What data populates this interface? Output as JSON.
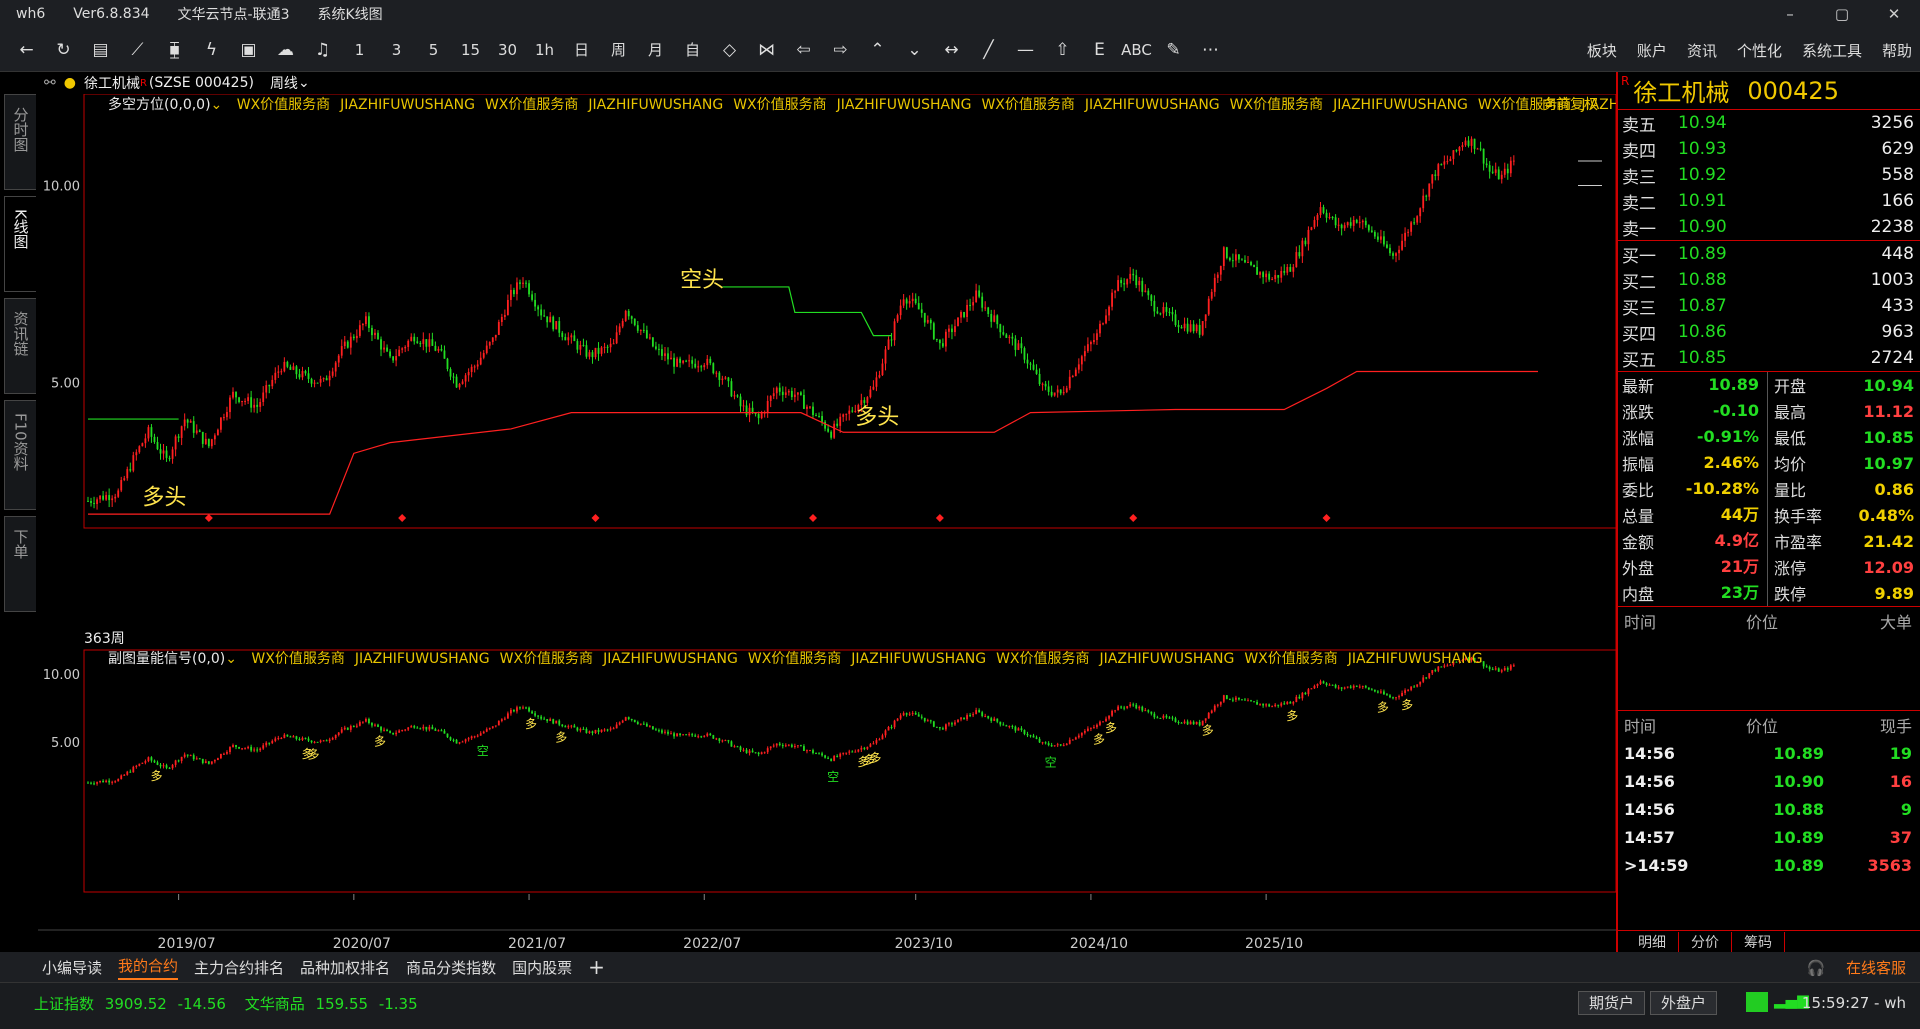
{
  "titlebar": {
    "app": "wh6",
    "version": "Ver6.8.834",
    "node": "文华云节点-联通3",
    "view": "系统K线图"
  },
  "window_controls": [
    "–",
    "▢",
    "✕"
  ],
  "toolbar": {
    "periods": [
      "1",
      "3",
      "5",
      "15",
      "30",
      "1h",
      "日",
      "周",
      "月",
      "自"
    ],
    "abc": "ABC",
    "right_menu": [
      "板块",
      "账户",
      "资讯",
      "个性化",
      "系统工具",
      "帮助"
    ]
  },
  "left_tabs": [
    "分时图",
    "K线图",
    "资讯链",
    "F10资料",
    "下单"
  ],
  "chart_info": {
    "name": "徐工机械",
    "tag": "R",
    "code": "(SZSE 000425)",
    "period": "周线"
  },
  "main_indicator": {
    "name": "多空方位(0,0,0)",
    "watermark": [
      "WX价值服务商",
      "JIAZHIFUWUSHANG",
      "WX价值服务商",
      "JIAZHIFUWUSHANG",
      "WX价值服务商",
      "JIAZHIFUWUSHANG",
      "WX价值服务商",
      "JIAZHIFUWUSHANG",
      "WX价值服务商",
      "JIAZHIFUWUSHANG",
      "WX价值服务商",
      "JIAZHIFUWUSHANG"
    ],
    "adjust": "向前复权",
    "bar_count": "363周"
  },
  "sub_indicator": {
    "name": "副图量能信号(0,0)",
    "watermark": [
      "WX价值服务商",
      "JIAZHIFUWUSHANG",
      "WX价值服务商",
      "JIAZHIFUWUSHANG",
      "WX价值服务商",
      "JIAZHIFUWUSHANG",
      "WX价值服务商",
      "JIAZHIFUWUSHANG",
      "WX价值服务商",
      "JIAZHIFUWUSHANG"
    ]
  },
  "chart_data": {
    "type": "candlestick",
    "period": "weekly",
    "x_ticks": [
      "2019/07",
      "2020/07",
      "2021/07",
      "2022/07",
      "2023/10",
      "2024/10",
      "2025/10"
    ],
    "y_ticks_main": [
      5.0,
      10.0
    ],
    "y_ticks_sub": [
      5.0,
      10.0
    ],
    "ylim": [
      3.0,
      12.5
    ],
    "close_path": [
      [
        0,
        3.3
      ],
      [
        10,
        3.4
      ],
      [
        16,
        3.9
      ],
      [
        20,
        4.2
      ],
      [
        26,
        3.8
      ],
      [
        32,
        4.4
      ],
      [
        40,
        4.0
      ],
      [
        48,
        4.8
      ],
      [
        56,
        4.6
      ],
      [
        64,
        5.3
      ],
      [
        72,
        5.1
      ],
      [
        78,
        5.0
      ],
      [
        84,
        5.6
      ],
      [
        92,
        6.2
      ],
      [
        100,
        5.4
      ],
      [
        108,
        5.9
      ],
      [
        116,
        5.6
      ],
      [
        122,
        5.0
      ],
      [
        128,
        5.3
      ],
      [
        134,
        5.8
      ],
      [
        140,
        6.8
      ],
      [
        144,
        7.2
      ],
      [
        150,
        6.4
      ],
      [
        158,
        5.9
      ],
      [
        166,
        5.5
      ],
      [
        174,
        5.7
      ],
      [
        178,
        6.5
      ],
      [
        182,
        6.1
      ],
      [
        188,
        5.6
      ],
      [
        196,
        5.3
      ],
      [
        204,
        5.4
      ],
      [
        210,
        5.1
      ],
      [
        216,
        4.6
      ],
      [
        222,
        4.4
      ],
      [
        228,
        4.9
      ],
      [
        234,
        4.8
      ],
      [
        240,
        4.5
      ],
      [
        246,
        4.2
      ],
      [
        252,
        4.5
      ],
      [
        260,
        4.9
      ],
      [
        266,
        5.9
      ],
      [
        270,
        6.8
      ],
      [
        276,
        6.4
      ],
      [
        282,
        5.7
      ],
      [
        288,
        6.2
      ],
      [
        294,
        6.8
      ],
      [
        298,
        6.4
      ],
      [
        304,
        5.9
      ],
      [
        310,
        5.5
      ],
      [
        316,
        4.9
      ],
      [
        322,
        4.8
      ],
      [
        328,
        5.4
      ],
      [
        334,
        5.9
      ],
      [
        340,
        7.0
      ],
      [
        346,
        7.3
      ],
      [
        352,
        6.6
      ],
      [
        360,
        6.2
      ],
      [
        368,
        6.0
      ],
      [
        376,
        7.9
      ],
      [
        384,
        7.5
      ],
      [
        392,
        7.2
      ],
      [
        398,
        7.5
      ],
      [
        402,
        8.1
      ],
      [
        408,
        9.3
      ],
      [
        414,
        8.6
      ],
      [
        420,
        8.9
      ],
      [
        426,
        8.4
      ],
      [
        432,
        7.8
      ],
      [
        436,
        8.4
      ],
      [
        440,
        9.1
      ],
      [
        446,
        10.5
      ],
      [
        452,
        11.1
      ],
      [
        456,
        11.8
      ],
      [
        460,
        11.5
      ],
      [
        464,
        10.5
      ],
      [
        468,
        10.3
      ],
      [
        472,
        10.9
      ]
    ],
    "support_line": [
      [
        0,
        3.15
      ],
      [
        80,
        3.15
      ],
      [
        88,
        3.9
      ],
      [
        100,
        4.05
      ],
      [
        140,
        4.25
      ],
      [
        160,
        4.5
      ],
      [
        206,
        4.5
      ],
      [
        236,
        4.5
      ],
      [
        250,
        4.2
      ],
      [
        300,
        4.2
      ],
      [
        312,
        4.5
      ],
      [
        360,
        4.55
      ],
      [
        396,
        4.55
      ],
      [
        410,
        4.9
      ],
      [
        420,
        5.2
      ],
      [
        480,
        5.2
      ]
    ],
    "resistance_line": [
      [
        0,
        4.4
      ],
      [
        30,
        4.4
      ]
    ],
    "resistance_line2": [
      [
        210,
        7.0
      ],
      [
        232,
        7.0
      ],
      [
        234,
        6.4
      ],
      [
        256,
        6.4
      ],
      [
        260,
        5.9
      ],
      [
        266,
        5.9
      ]
    ],
    "signals": [
      {
        "label": "多头",
        "x": 18,
        "y": 3.35,
        "color": "#ffe44d"
      },
      {
        "label": "空头",
        "x": 196,
        "y": 7.2,
        "color": "#ffe44d"
      },
      {
        "label": "多头",
        "x": 254,
        "y": 4.45,
        "color": "#ffe44d"
      }
    ],
    "diamonds_x": [
      40,
      104,
      168,
      240,
      282,
      346,
      410
    ],
    "sub_marks": [
      {
        "t": "多",
        "x": 22
      },
      {
        "t": "多",
        "x": 72
      },
      {
        "t": "多",
        "x": 74
      },
      {
        "t": "多",
        "x": 96
      },
      {
        "t": "空",
        "x": 130
      },
      {
        "t": "多",
        "x": 146
      },
      {
        "t": "多",
        "x": 156
      },
      {
        "t": "空",
        "x": 246
      },
      {
        "t": "多",
        "x": 256
      },
      {
        "t": "多",
        "x": 258
      },
      {
        "t": "多",
        "x": 260
      },
      {
        "t": "空",
        "x": 318
      },
      {
        "t": "多",
        "x": 334
      },
      {
        "t": "多",
        "x": 338
      },
      {
        "t": "多",
        "x": 370
      },
      {
        "t": "多",
        "x": 398
      },
      {
        "t": "多",
        "x": 428
      },
      {
        "t": "多",
        "x": 436
      }
    ]
  },
  "quote": {
    "name": "徐工机械",
    "tag": "R",
    "code": "000425",
    "asks": [
      {
        "label": "卖五",
        "price": "10.94",
        "vol": "3256"
      },
      {
        "label": "卖四",
        "price": "10.93",
        "vol": "629"
      },
      {
        "label": "卖三",
        "price": "10.92",
        "vol": "558"
      },
      {
        "label": "卖二",
        "price": "10.91",
        "vol": "166"
      },
      {
        "label": "卖一",
        "price": "10.90",
        "vol": "2238"
      }
    ],
    "bids": [
      {
        "label": "买一",
        "price": "10.89",
        "vol": "448"
      },
      {
        "label": "买二",
        "price": "10.88",
        "vol": "1003"
      },
      {
        "label": "买三",
        "price": "10.87",
        "vol": "433"
      },
      {
        "label": "买四",
        "price": "10.86",
        "vol": "963"
      },
      {
        "label": "买五",
        "price": "10.85",
        "vol": "2724"
      }
    ],
    "stats": [
      {
        "l1": "最新",
        "v1": "10.89",
        "c1": "#22dd22",
        "l2": "开盘",
        "v2": "10.94",
        "c2": "#22dd22"
      },
      {
        "l1": "涨跌",
        "v1": "-0.10",
        "c1": "#22dd22",
        "l2": "最高",
        "v2": "11.12",
        "c2": "#ff4040"
      },
      {
        "l1": "涨幅",
        "v1": "-0.91%",
        "c1": "#22dd22",
        "l2": "最低",
        "v2": "10.85",
        "c2": "#22dd22"
      },
      {
        "l1": "振幅",
        "v1": "2.46%",
        "c1": "#f0d000",
        "l2": "均价",
        "v2": "10.97",
        "c2": "#22dd22"
      },
      {
        "l1": "委比",
        "v1": "-10.28%",
        "c1": "#f0d000",
        "l2": "量比",
        "v2": "0.86",
        "c2": "#f0d000"
      },
      {
        "l1": "总量",
        "v1": "44万",
        "c1": "#f0d000",
        "l2": "换手率",
        "v2": "0.48%",
        "c2": "#f0d000"
      },
      {
        "l1": "金额",
        "v1": "4.9亿",
        "c1": "#ff4040",
        "l2": "市盈率",
        "v2": "21.42",
        "c2": "#f0d000"
      },
      {
        "l1": "外盘",
        "v1": "21万",
        "c1": "#ff4040",
        "l2": "涨停",
        "v2": "12.09",
        "c2": "#ff4040"
      },
      {
        "l1": "内盘",
        "v1": "23万",
        "c1": "#22dd22",
        "l2": "跌停",
        "v2": "9.89",
        "c2": "#f0d000"
      }
    ],
    "big_head": [
      "时间",
      "价位",
      "大单"
    ],
    "ticks_head": [
      "时间",
      "价位",
      "现手"
    ],
    "ticks": [
      {
        "time": "14:56",
        "price": "10.89",
        "vol": "19",
        "vc": "#22dd22"
      },
      {
        "time": "14:56",
        "price": "10.90",
        "vol": "16",
        "vc": "#ff4040"
      },
      {
        "time": "14:56",
        "price": "10.88",
        "vol": "9",
        "vc": "#22dd22"
      },
      {
        "time": "14:57",
        "price": "10.89",
        "vol": "37",
        "vc": "#ff4040"
      },
      {
        "time": ">14:59",
        "price": "10.89",
        "vol": "3563",
        "vc": "#ff4040"
      }
    ],
    "bottom_tabs": [
      "明细",
      "分价",
      "筹码"
    ]
  },
  "bottom_tabs": [
    "小编导读",
    "我的合约",
    "主力合约排名",
    "品种加权排名",
    "商品分类指数",
    "国内股票"
  ],
  "bottom_active": "我的合约",
  "bottom_add": "+",
  "service": "在线客服",
  "status": {
    "idx1_name": "上证指数",
    "idx1_val": "3909.52",
    "idx1_chg": "-14.56",
    "idx2_name": "文华商品",
    "idx2_val": "159.55",
    "idx2_chg": "-1.35",
    "btn_futures": "期货户",
    "btn_foreign": "外盘户",
    "clock": "15:59:27 - wh"
  },
  "colors": {
    "up": "#ff2020",
    "down": "#22dd22",
    "accent": "#f0c800",
    "grid": "#c00000"
  }
}
